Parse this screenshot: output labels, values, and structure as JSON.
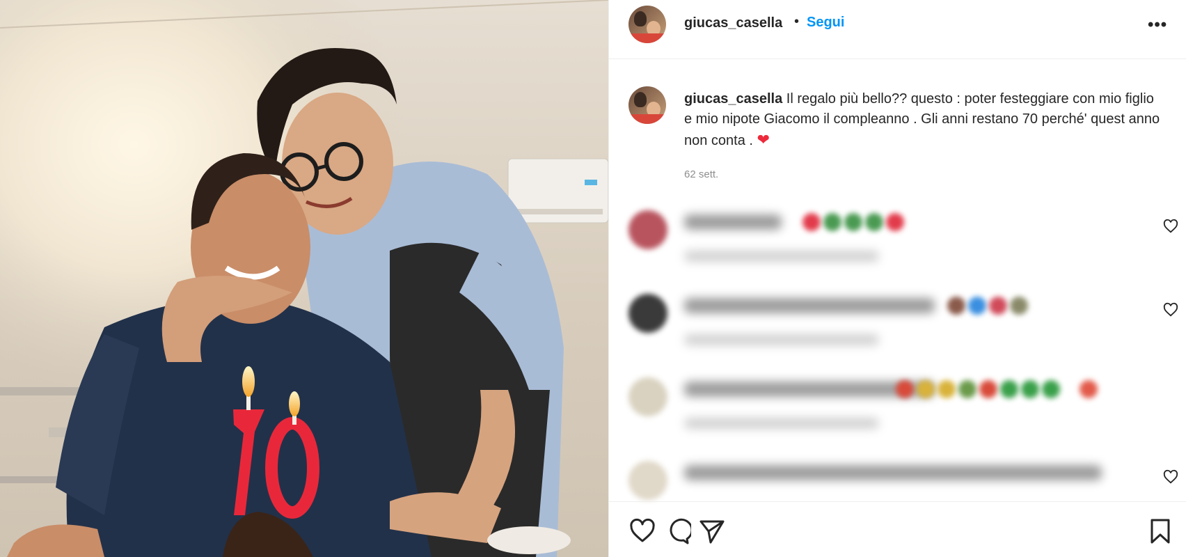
{
  "post": {
    "username": "giucas_casella",
    "separator": "•",
    "follow_label": "Segui",
    "more_label": "•••"
  },
  "caption": {
    "username": "giucas_casella",
    "text": "Il regalo più bello?? questo : poter festeggiare con mio figlio e mio nipote Giacomo il compleanno . Gli anni restano 70 perché' quest anno non conta .",
    "emoji": "❤",
    "time": "62 sett."
  },
  "photo": {
    "candle_numbers": "70"
  },
  "icons": {
    "like": "heart-outline-icon",
    "comment": "comment-bubble-icon",
    "share": "paper-plane-icon",
    "save": "bookmark-icon",
    "comment_like": "heart-outline-icon"
  },
  "colors": {
    "follow_blue": "#0095f6",
    "heart_red": "#ed2a3b",
    "text_primary": "#262626",
    "text_secondary": "#8e8e8e"
  }
}
